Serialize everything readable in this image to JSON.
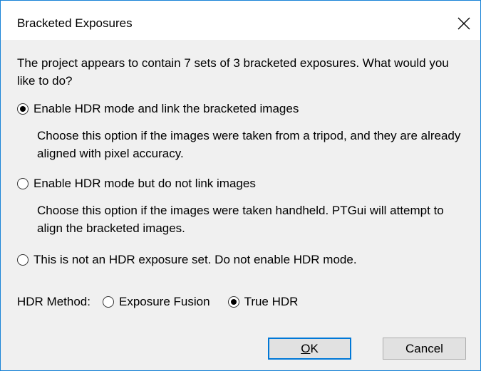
{
  "dialog": {
    "title": "Bracketed Exposures",
    "close_icon": "close-icon"
  },
  "intro_text": "The project appears to contain 7 sets of 3 bracketed exposures. What would you like to do?",
  "options": [
    {
      "label": "Enable HDR mode and link the bracketed images",
      "description": "Choose this option if the images were taken from a tripod, and they are already aligned with pixel accuracy.",
      "checked": true
    },
    {
      "label": "Enable HDR mode but do not link images",
      "description": "Choose this option if the images were taken handheld. PTGui will attempt to align the bracketed images.",
      "checked": false
    },
    {
      "label": "This is not an HDR exposure set. Do not enable HDR mode.",
      "checked": false
    }
  ],
  "hdr_method": {
    "label": "HDR Method:",
    "options": [
      {
        "label": "Exposure Fusion",
        "checked": false
      },
      {
        "label": "True HDR",
        "checked": true
      }
    ]
  },
  "buttons": {
    "ok_mnemonic": "O",
    "ok_rest": "K",
    "cancel": "Cancel"
  },
  "colors": {
    "window_border": "#1883d7",
    "default_button_border": "#0078d7",
    "background": "#f0f0f0"
  }
}
